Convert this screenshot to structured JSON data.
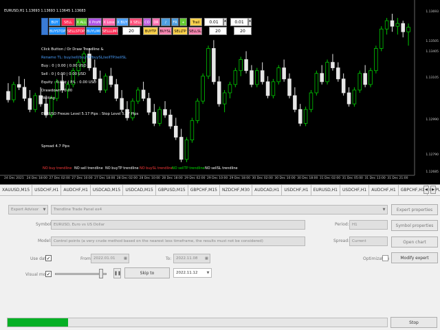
{
  "chart": {
    "symbol_label": "EURUSD,H1  1.13693 1.13693 1.13645 1.13683",
    "bull_color": "#00c800",
    "bear_color": "#e6e6e6",
    "price_labels": [
      "1.13693",
      "1.13505",
      "1.13405",
      "1.13105",
      "1.12990",
      "1.12790",
      "1.12685"
    ],
    "dates": [
      "24 Dec 2021",
      "24 Dec 18:00",
      "27 Dec 02:00",
      "27 Dec 10:00",
      "27 Dec 18:00",
      "28 Dec 02:00",
      "28 Dec 10:00",
      "28 Dec 18:00",
      "29 Dec 02:00",
      "29 Dec 10:00",
      "29 Dec 18:00",
      "30 Dec 02:00",
      "30 Dec 10:00",
      "30 Dec 18:00",
      "31 Dec 02:00",
      "31 Dec 05:00",
      "31 Dec 13:00",
      "31 Dec 21:00"
    ],
    "candles": [
      [
        1.1323,
        1.1329,
        1.1315,
        1.1317
      ],
      [
        1.1317,
        1.133,
        1.1315,
        1.1328
      ],
      [
        1.1328,
        1.1334,
        1.1324,
        1.1326
      ],
      [
        1.1326,
        1.1332,
        1.1316,
        1.1318
      ],
      [
        1.1318,
        1.1324,
        1.1308,
        1.131
      ],
      [
        1.131,
        1.1322,
        1.1308,
        1.132
      ],
      [
        1.132,
        1.1326,
        1.1312,
        1.1314
      ],
      [
        1.1314,
        1.132,
        1.1304,
        1.1306
      ],
      [
        1.1306,
        1.132,
        1.1304,
        1.1318
      ],
      [
        1.1318,
        1.1332,
        1.1316,
        1.133
      ],
      [
        1.133,
        1.1336,
        1.1322,
        1.1324
      ],
      [
        1.1324,
        1.133,
        1.1318,
        1.1328
      ],
      [
        1.1328,
        1.134,
        1.1326,
        1.1338
      ],
      [
        1.1338,
        1.1346,
        1.1334,
        1.1344
      ],
      [
        1.1344,
        1.1352,
        1.134,
        1.135
      ],
      [
        1.135,
        1.1354,
        1.1338,
        1.134
      ],
      [
        1.134,
        1.1346,
        1.133,
        1.1332
      ],
      [
        1.1332,
        1.1338,
        1.1322,
        1.1324
      ],
      [
        1.1324,
        1.1336,
        1.1322,
        1.1334
      ],
      [
        1.1334,
        1.134,
        1.1326,
        1.1328
      ],
      [
        1.1328,
        1.1332,
        1.1316,
        1.1318
      ],
      [
        1.1318,
        1.1324,
        1.1308,
        1.131
      ],
      [
        1.131,
        1.1316,
        1.1302,
        1.1304
      ],
      [
        1.1304,
        1.1318,
        1.1302,
        1.1316
      ],
      [
        1.1316,
        1.1326,
        1.1314,
        1.1324
      ],
      [
        1.1324,
        1.133,
        1.1316,
        1.1318
      ],
      [
        1.1318,
        1.1322,
        1.1306,
        1.1308
      ],
      [
        1.1308,
        1.1314,
        1.1298,
        1.13
      ],
      [
        1.13,
        1.1312,
        1.1298,
        1.131
      ],
      [
        1.131,
        1.1316,
        1.1304,
        1.1306
      ],
      [
        1.1306,
        1.131,
        1.1296,
        1.1298
      ],
      [
        1.1298,
        1.1304,
        1.1288,
        1.129
      ],
      [
        1.129,
        1.1296,
        1.1272,
        1.1274
      ],
      [
        1.1274,
        1.129,
        1.1272,
        1.1288
      ],
      [
        1.1288,
        1.1304,
        1.1286,
        1.1302
      ],
      [
        1.1302,
        1.1318,
        1.13,
        1.1316
      ],
      [
        1.1316,
        1.1336,
        1.1314,
        1.1334
      ],
      [
        1.1334,
        1.1356,
        1.1332,
        1.1354
      ],
      [
        1.1354,
        1.136,
        1.1328,
        1.133
      ],
      [
        1.133,
        1.1334,
        1.1312,
        1.1314
      ],
      [
        1.1314,
        1.1324,
        1.1308,
        1.1322
      ],
      [
        1.1322,
        1.133,
        1.1318,
        1.1328
      ],
      [
        1.1328,
        1.134,
        1.1326,
        1.1338
      ],
      [
        1.1338,
        1.1348,
        1.1334,
        1.1346
      ],
      [
        1.1346,
        1.1352,
        1.1336,
        1.1338
      ],
      [
        1.1338,
        1.1342,
        1.1326,
        1.1328
      ],
      [
        1.1328,
        1.134,
        1.1326,
        1.1338
      ],
      [
        1.1338,
        1.1344,
        1.1328,
        1.133
      ],
      [
        1.133,
        1.1334,
        1.1318,
        1.132
      ],
      [
        1.132,
        1.1332,
        1.1318,
        1.133
      ],
      [
        1.133,
        1.1342,
        1.1328,
        1.134
      ],
      [
        1.134,
        1.1346,
        1.133,
        1.1332
      ],
      [
        1.1332,
        1.1336,
        1.1318,
        1.132
      ],
      [
        1.132,
        1.1326,
        1.1308,
        1.131
      ],
      [
        1.131,
        1.1314,
        1.1298,
        1.13
      ],
      [
        1.13,
        1.1312,
        1.1298,
        1.131
      ],
      [
        1.131,
        1.1324,
        1.1308,
        1.1322
      ],
      [
        1.1322,
        1.1338,
        1.132,
        1.1336
      ],
      [
        1.1336,
        1.1342,
        1.1328,
        1.133
      ],
      [
        1.133,
        1.1346,
        1.1328,
        1.1344
      ],
      [
        1.1344,
        1.135,
        1.1338,
        1.134
      ],
      [
        1.134,
        1.1344,
        1.133,
        1.1332
      ],
      [
        1.1332,
        1.1336,
        1.132,
        1.1322
      ],
      [
        1.1322,
        1.1326,
        1.1312,
        1.1314
      ],
      [
        1.1314,
        1.1326,
        1.1312,
        1.1324
      ],
      [
        1.1324,
        1.1338,
        1.1322,
        1.1336
      ],
      [
        1.1336,
        1.1342,
        1.1326,
        1.1328
      ],
      [
        1.1328,
        1.134,
        1.1326,
        1.1338
      ],
      [
        1.1338,
        1.1356,
        1.1336,
        1.1354
      ],
      [
        1.1354,
        1.137,
        1.1352,
        1.1368
      ],
      [
        1.1368,
        1.1376,
        1.1364,
        1.1374
      ],
      [
        1.1374,
        1.1379,
        1.1366,
        1.137
      ],
      [
        1.137,
        1.1376,
        1.1364,
        1.1372
      ],
      [
        1.1372,
        1.1374,
        1.1362,
        1.1366
      ],
      [
        1.1366,
        1.1372,
        1.1356,
        1.13693
      ]
    ],
    "info_lines": [
      "Click Button / Or Draw Trendline &",
      "Rename TL: buy/sell/buyTP/buySL/sellTP/sellSL",
      "Buy : 0 | 0.00 | 0.00 USD",
      "Sell : 0 | 0.00 | 0.00 USD",
      "Equity : 0.00¢ | P/L : 0.00 USD",
      "Drawdown : 0.00",
      "Waiting",
      "EURUSD Freeze Level 5.17 Pips : Stop Level 5.17 Pips",
      "Spread 4.7 Pips"
    ],
    "trend_labels": [
      {
        "text": "NO buy trendline",
        "color": "#ff3b3b"
      },
      {
        "text": "NO sell trendline",
        "color": "#ffffff"
      },
      {
        "text": "NO buyTP trendline",
        "color": "#ffffff"
      },
      {
        "text": "NO buySL trendline",
        "color": "#ff3b3b"
      },
      {
        "text": "NO sellTP trendline",
        "color": "#00e000"
      },
      {
        "text": "NO sellSL trendline",
        "color": "#ffffff"
      }
    ],
    "panel": {
      "buy": "BUY",
      "sell": "SELL",
      "x_all": "X ALL",
      "x_profit": "X Profit",
      "x_loss": "X Loss",
      "x_buy": "X BUY",
      "x_sell": "X SELL",
      "co": "CO",
      "dr": "DR",
      "fr": "FR",
      "plus": "+",
      "trail": "Trail",
      "lot1": "0.01",
      "lot2": "0.01",
      "buystop": "BUYSTOP",
      "sellstop": "SELLSTOP",
      "buylimit": "BUYLIMIT",
      "selllimit": "SELLLIMIT",
      "num1": "20",
      "buytp": "BUYTP",
      "buysl": "BUYSL",
      "selltp": "SELLTP",
      "sellsl": "SELLSL",
      "num2": "20"
    }
  },
  "tabs": [
    "XAUUSD,M15",
    "USDCHF,H1",
    "AUDCHF,H1",
    "USDCAD,M15",
    "USDCAD,M15",
    "GBPUSD,M15",
    "GBPCHF,M15",
    "NZDCHF,M30",
    "AUDCAD,H1",
    "USDCHF,H1",
    "EURUSD,H1",
    "USDCHF,H1",
    "AUDCHF,H1",
    "GBPCHF,H1",
    "GBPUSD,H1"
  ],
  "tester": {
    "ea_type": "Expert Advisor",
    "ea_name": "Trendline Trade Panel ex4",
    "symbol_label": "Symbol:",
    "symbol_value": "EURUSD, Euro vs US Dollar",
    "model_label": "Model:",
    "model_value": "Control points (a very crude method based on the nearest less timeframe, the results must not be considered)",
    "use_date_label": "Use date",
    "from_label": "From:",
    "from_value": "2022.01.01",
    "to_label": "To:",
    "to_value": "2022.11.08",
    "visual_mode_label": "Visual mode",
    "skip_to_label": "Skip to",
    "skip_date": "2022.11.12",
    "period_label": "Period:",
    "period_value": "H1",
    "spread_label": "Spread:",
    "spread_value": "Current",
    "optimization_label": "Optimization",
    "btn_expert_props": "Expert properties",
    "btn_symbol_props": "Symbol properties",
    "btn_open_chart": "Open chart",
    "btn_modify_expert": "Modify expert",
    "btn_stop": "Stop",
    "progress": 0.16
  }
}
